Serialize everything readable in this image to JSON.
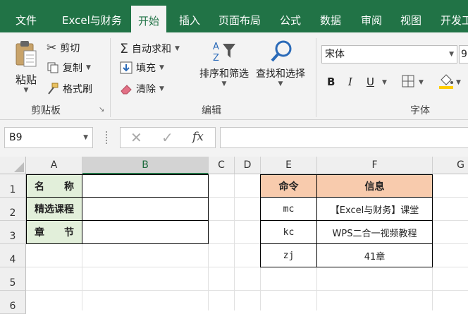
{
  "tabs": [
    "文件",
    "Excel与财务",
    "开始",
    "插入",
    "页面布局",
    "公式",
    "数据",
    "审阅",
    "视图",
    "开发工"
  ],
  "ribbon": {
    "paste": "粘贴",
    "cut": "剪切",
    "copy": "复制",
    "format_painter": "格式刷",
    "clipboard_group": "剪贴板",
    "autosum": "自动求和",
    "fill": "填充",
    "clear": "清除",
    "sort_filter": "排序和筛选",
    "find_select": "查找和选择",
    "edit_group": "编辑",
    "font_name": "宋体",
    "font_size": "9",
    "bold": "B",
    "italic": "I",
    "underline": "U",
    "font_group": "字体"
  },
  "formula_bar": {
    "name_box": "B9",
    "fx": "fx",
    "formula": ""
  },
  "columns": [
    "A",
    "B",
    "C",
    "D",
    "E",
    "F",
    "G"
  ],
  "rows": [
    "1",
    "2",
    "3",
    "4",
    "5",
    "6"
  ],
  "left_table": [
    {
      "label": "名　　称",
      "value": ""
    },
    {
      "label": "精选课程",
      "value": ""
    },
    {
      "label": "章　　节",
      "value": ""
    }
  ],
  "right_table": {
    "headers": [
      "命令",
      "信息"
    ],
    "rows": [
      [
        "mc",
        "【Excel与财务】课堂"
      ],
      [
        "kc",
        "WPS二合一视频教程"
      ],
      [
        "zj",
        "41章"
      ]
    ]
  },
  "colors": {
    "brand": "#217346",
    "label_fill": "#e2efda",
    "header_fill": "#f8cbad"
  }
}
